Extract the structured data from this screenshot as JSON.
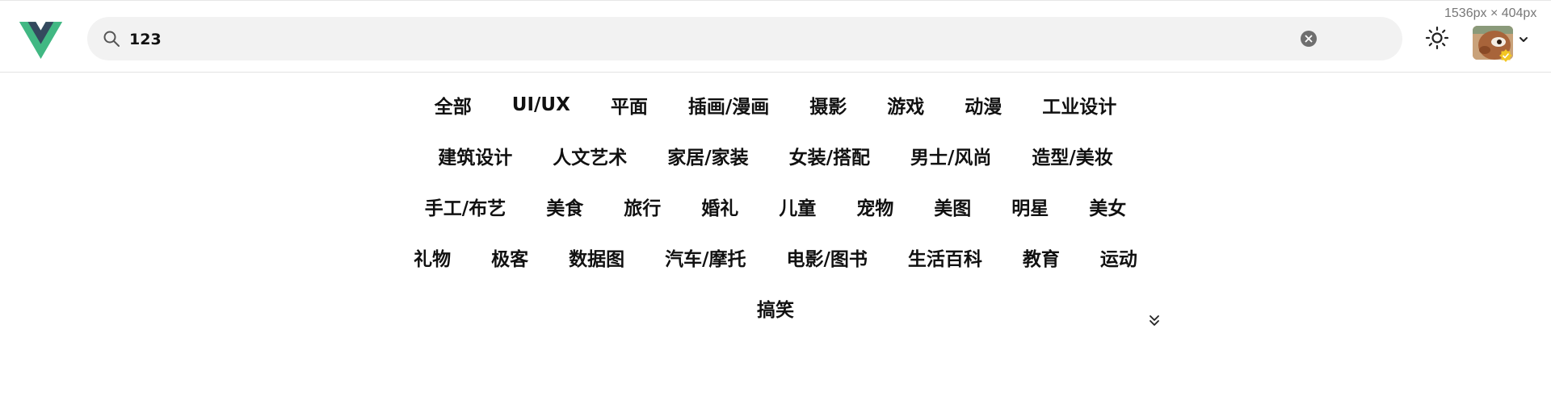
{
  "header": {
    "logo_icon": "vue-logo-icon",
    "search": {
      "value": "123",
      "placeholder": "",
      "icon": "search-icon",
      "clear_icon": "clear-icon"
    },
    "theme_icon": "sun-icon",
    "avatar_icon": "avatar-image",
    "badge_icon": "verified-badge-icon",
    "menu_icon": "chevron-down-icon",
    "dimension_tooltip": "1536px × 404px"
  },
  "categories": {
    "rows": [
      [
        "全部",
        "UI/UX",
        "平面",
        "插画/漫画",
        "摄影",
        "游戏",
        "动漫",
        "工业设计"
      ],
      [
        "建筑设计",
        "人文艺术",
        "家居/家装",
        "女装/搭配",
        "男士/风尚",
        "造型/美妆"
      ],
      [
        "手工/布艺",
        "美食",
        "旅行",
        "婚礼",
        "儿童",
        "宠物",
        "美图",
        "明星",
        "美女"
      ],
      [
        "礼物",
        "极客",
        "数据图",
        "汽车/摩托",
        "电影/图书",
        "生活百科",
        "教育",
        "运动"
      ],
      [
        "搞笑"
      ]
    ],
    "expand_icon": "double-chevron-down-icon"
  },
  "colors": {
    "accent_green": "#41b883",
    "accent_dark": "#34495e",
    "search_bg": "#f2f2f2",
    "badge_yellow": "#f3c623"
  }
}
